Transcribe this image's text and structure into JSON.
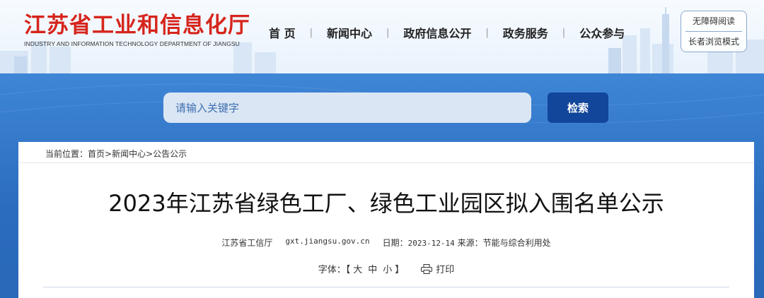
{
  "site": {
    "title_cn": "江苏省工业和信息化厅",
    "title_en": "INDUSTRY AND INFORMATION TECHNOLOGY DEPARTMENT OF JIANGSU"
  },
  "nav": {
    "items": [
      "首 页",
      "新闻中心",
      "政府信息公开",
      "政务服务",
      "公众参与"
    ],
    "separator": "|"
  },
  "accessibility": {
    "barrier_free": "无障碍阅读",
    "elder_mode": "长者浏览模式"
  },
  "search": {
    "placeholder": "请输入关键字",
    "button_label": "检索"
  },
  "breadcrumb": {
    "prefix": "当前位置：",
    "items": [
      "首页",
      "新闻中心",
      "公告公示"
    ],
    "separator": ">"
  },
  "article": {
    "title": "2023年江苏省绿色工厂、绿色工业园区拟入围名单公示",
    "publisher": "江苏省工信厅",
    "site_url": "gxt.jiangsu.gov.cn",
    "date_label": "日期：",
    "date": "2023-12-14",
    "source_label": "来源：",
    "source": "节能与综合利用处"
  },
  "tools": {
    "font_label": "字体：【",
    "font_large": "大",
    "font_medium": "中",
    "font_small": "小",
    "font_close": "】",
    "print_label": "打印",
    "print_icon": "printer-icon"
  },
  "colors": {
    "brand_red": "#d6251c",
    "band_blue": "#2f6fbf",
    "button_blue": "#12469a"
  }
}
